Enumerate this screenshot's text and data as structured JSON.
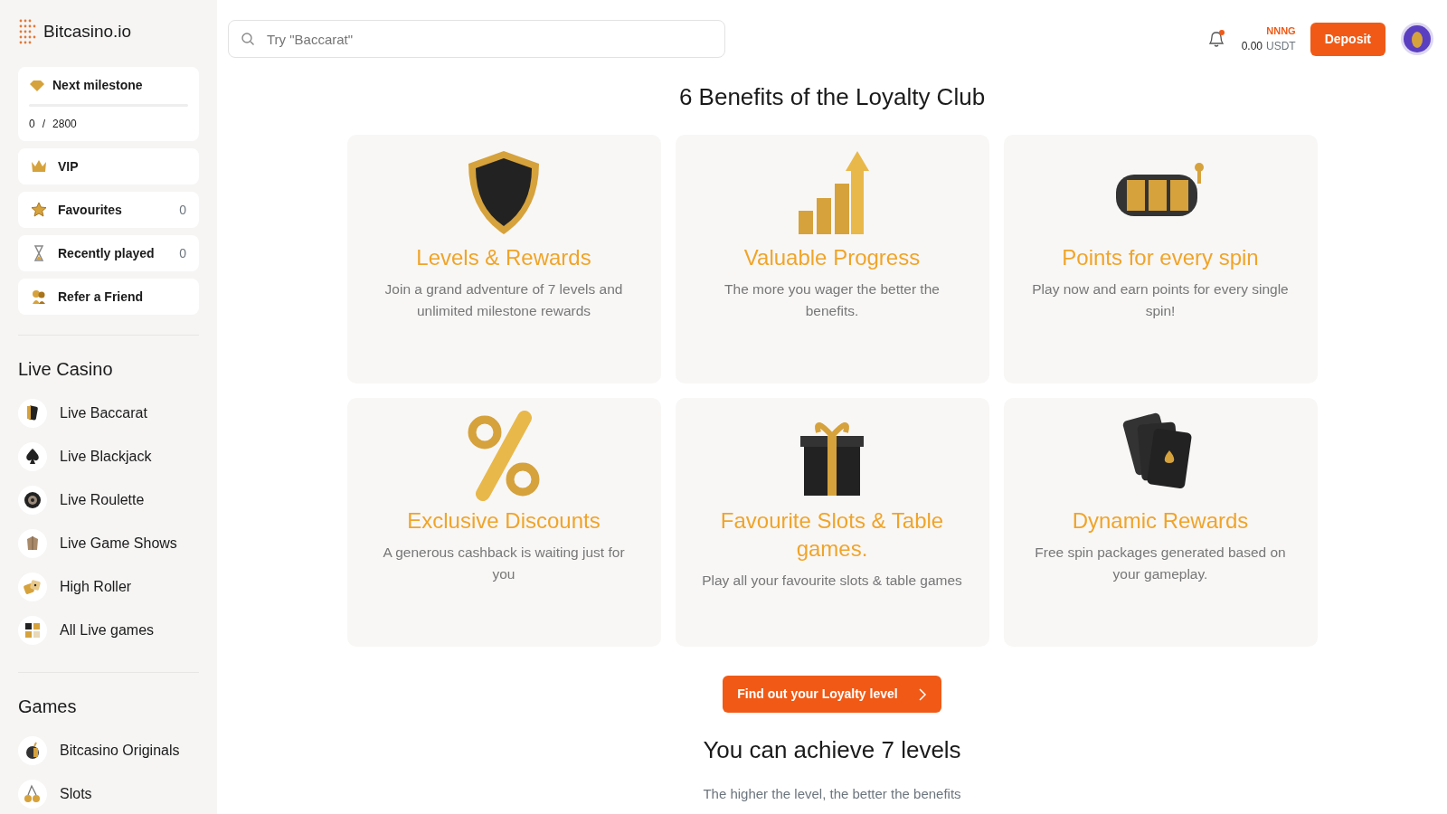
{
  "brand": {
    "name": "Bitcasino.io"
  },
  "sidebar": {
    "milestone": {
      "title": "Next milestone",
      "current": "0",
      "separator": "/",
      "target": "2800",
      "level": 0
    },
    "quick_links": [
      {
        "label": "VIP"
      },
      {
        "label": "Favourites",
        "count": "0"
      },
      {
        "label": "Recently played",
        "count": "0"
      },
      {
        "label": "Refer a Friend"
      }
    ],
    "sections": [
      {
        "title": "Live Casino",
        "items": [
          {
            "label": "Live Baccarat"
          },
          {
            "label": "Live Blackjack"
          },
          {
            "label": "Live Roulette"
          },
          {
            "label": "Live Game Shows"
          },
          {
            "label": "High Roller"
          },
          {
            "label": "All Live games"
          }
        ]
      },
      {
        "title": "Games",
        "items": [
          {
            "label": "Bitcasino Originals"
          },
          {
            "label": "Slots"
          }
        ]
      }
    ]
  },
  "search": {
    "placeholder": "Try \"Baccarat\""
  },
  "account": {
    "username": "NNNG",
    "balance": "0.00",
    "currency": "USDT",
    "deposit": "Deposit"
  },
  "benefits": {
    "title": "6 Benefits of the Loyalty Club",
    "cards": [
      {
        "kind": "shield",
        "title": "Levels & Rewards",
        "text": "Join a grand adventure of 7 levels and unlimited milestone rewards"
      },
      {
        "kind": "chart",
        "title": "Valuable Progress",
        "text": "The more you wager the better the benefits."
      },
      {
        "kind": "slot",
        "title": "Points for every spin",
        "text": "Play now and earn points for every single spin!"
      },
      {
        "kind": "percent",
        "title": "Exclusive Discounts",
        "text": "A generous cashback is waiting just for you"
      },
      {
        "kind": "gift",
        "title": "Favourite Slots & Table games.",
        "text": "Play all your favourite slots & table games"
      },
      {
        "kind": "cards",
        "title": "Dynamic Rewards",
        "text": "Free spin packages generated based on your gameplay."
      }
    ]
  },
  "cta": {
    "label": "Find out your Loyalty level"
  },
  "levels": {
    "title": "You can achieve 7 levels",
    "subtitle": "The higher the level, the better the benefits"
  }
}
